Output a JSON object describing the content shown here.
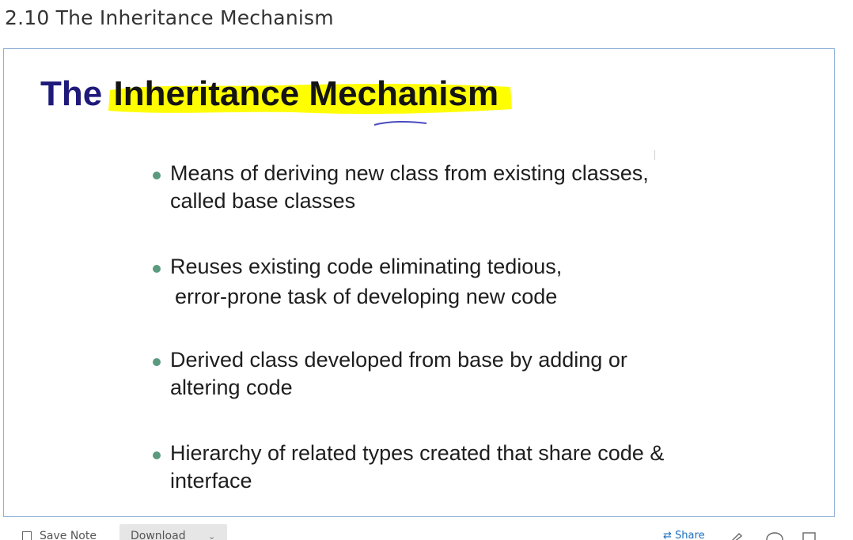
{
  "page": {
    "heading": "2.10 The Inheritance Mechanism"
  },
  "slide": {
    "title_part1": "The",
    "title_highlight": "Inheritance Mechanism",
    "highlight_color": "#ffff00",
    "title_color": "#1f1a7a",
    "bullet_color": "#5a9a7e",
    "bullets": [
      {
        "lines": [
          "Means of deriving new class from existing classes,",
          "called base classes"
        ]
      },
      {
        "lines": [
          "Reuses existing code eliminating tedious,",
          "error-prone task of developing new code"
        ]
      },
      {
        "lines": [
          "Derived class developed from base by adding or",
          "altering code"
        ]
      },
      {
        "lines": [
          "Hierarchy of related types created that share code &",
          "interface"
        ]
      }
    ]
  },
  "toolbar": {
    "save_note_label": "Save Note",
    "save_note_icon": "note-icon",
    "download_label": "Download",
    "download_icon": "chevron-down-icon",
    "share_label": "Share",
    "share_icon": "share-icon",
    "edit_icon": "pencil-icon",
    "comment_icon": "comment-icon",
    "expand_icon": "square-icon"
  }
}
